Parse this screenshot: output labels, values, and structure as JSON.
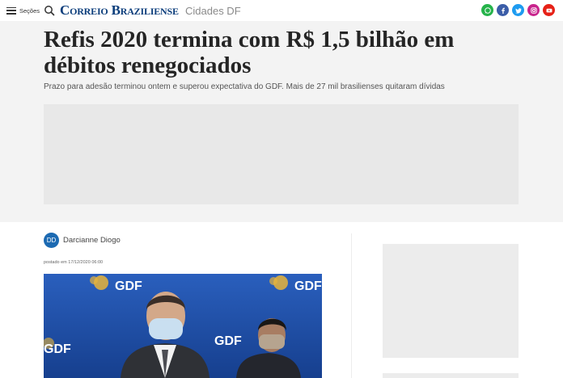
{
  "header": {
    "menu_label": "Seções",
    "logo_text": "Correio Braziliense",
    "section": "Cidades DF",
    "social": [
      "whatsapp-icon",
      "facebook-icon",
      "twitter-icon",
      "instagram-icon",
      "youtube-icon"
    ]
  },
  "article": {
    "title": "Refis 2020 termina com R$ 1,5 bilhão em débitos renegociados",
    "subtitle": "Prazo para adesão terminou ontem e superou expectativa do GDF. Mais de 27 mil brasilienses quitaram dívidas",
    "author": {
      "initials": "DD",
      "name": "Darcianne Diogo"
    },
    "posted": "postado em 17/12/2020 06:00",
    "photo_banner_texts": [
      "GDF",
      "GDF",
      "GDF",
      "GDF"
    ]
  },
  "colors": {
    "brand": "#0c3e7c",
    "avatar": "#1c6ab2",
    "photo_background": "#1f4fa8"
  }
}
